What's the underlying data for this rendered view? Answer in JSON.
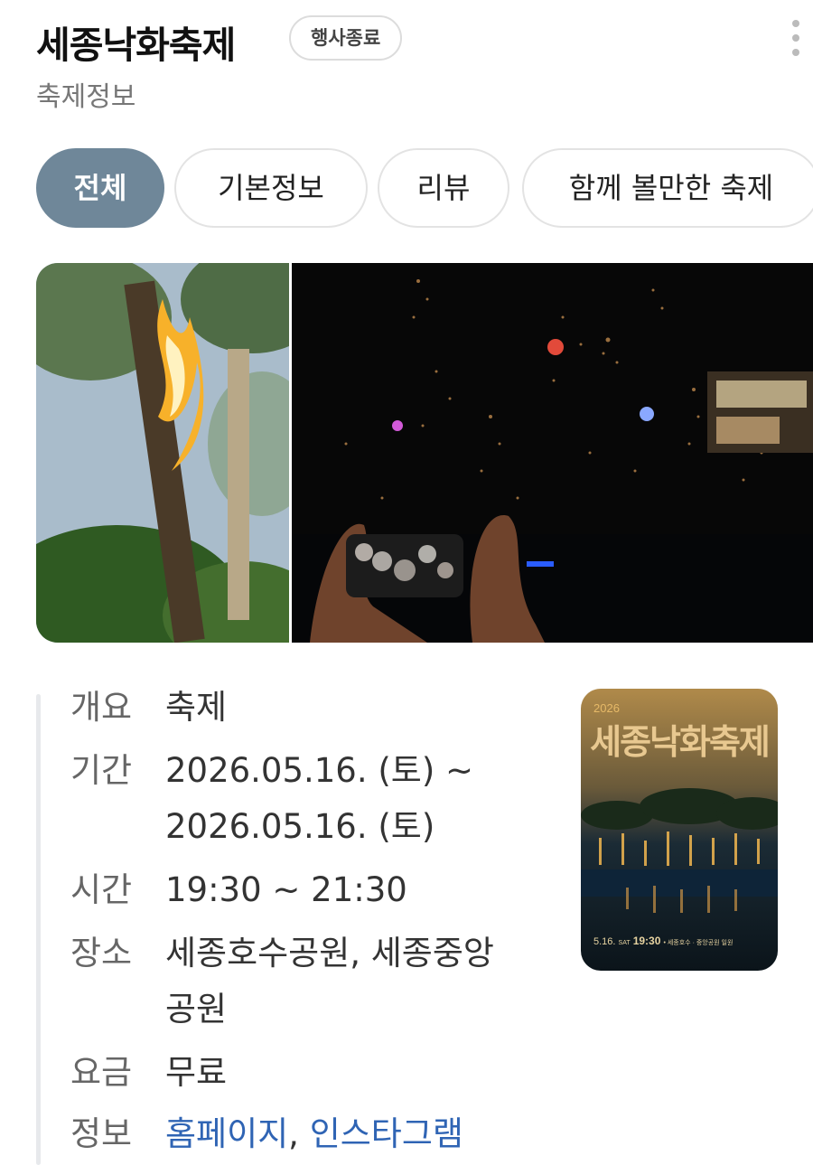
{
  "header": {
    "title": "세종낙화축제",
    "status_badge": "행사종료",
    "subtitle": "축제정보"
  },
  "tabs": [
    {
      "label": "전체",
      "active": true
    },
    {
      "label": "기본정보",
      "active": false
    },
    {
      "label": "리뷰",
      "active": false
    },
    {
      "label": "함께 볼만한 축제",
      "active": false
    }
  ],
  "info": {
    "overview": {
      "label": "개요",
      "value": "축제"
    },
    "period": {
      "label": "기간",
      "value_line1": "2026.05.16. (토) ~",
      "value_line2": "2026.05.16. (토)"
    },
    "time": {
      "label": "시간",
      "value": "19:30 ~ 21:30"
    },
    "place": {
      "label": "장소",
      "value_line1": "세종호수공원, 세종중앙",
      "value_line2": "공원"
    },
    "fee": {
      "label": "요금",
      "value": "무료"
    },
    "links": {
      "label": "정보",
      "homepage": "홈페이지",
      "separator": ",",
      "instagram": "인스타그램"
    }
  },
  "poster": {
    "year": "2026",
    "title": "세종낙화축제",
    "date": "5.16.",
    "day": "SAT",
    "time": "19:30",
    "venue": "• 세종호수 · 중앙공원 일원"
  },
  "colors": {
    "active_tab": "#6f8799",
    "link": "#2f64b4",
    "poster_title": "#e8c890"
  }
}
